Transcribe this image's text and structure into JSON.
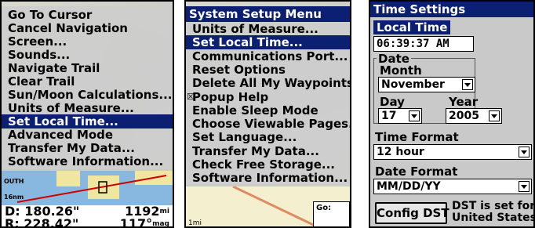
{
  "panel_left": {
    "menu_items": [
      {
        "label": "Go To Cursor",
        "selected": false
      },
      {
        "label": "Cancel Navigation",
        "selected": false
      },
      {
        "label": "Screen...",
        "selected": false
      },
      {
        "label": "Sounds...",
        "selected": false
      },
      {
        "label": "Navigate Trail",
        "selected": false
      },
      {
        "label": "Clear Trail",
        "selected": false
      },
      {
        "label": "Sun/Moon Calculations...",
        "selected": false
      },
      {
        "label": "Units of Measure...",
        "selected": false
      },
      {
        "label": "Set Local Time...",
        "selected": true
      },
      {
        "label": "Advanced Mode",
        "selected": false
      },
      {
        "label": "Transfer My Data...",
        "selected": false
      },
      {
        "label": "Software Information...",
        "selected": false
      }
    ],
    "map_label": "OUTH",
    "map_label2": "16nm",
    "readout": {
      "d_label": "D:",
      "d_value": "180.26\"",
      "d_right": "1192",
      "d_right_unit": "mi",
      "r_label": "R:",
      "r_value": "228.42\"",
      "r_right": "117°",
      "r_right_unit": "mag"
    }
  },
  "panel_middle": {
    "title": "System Setup Menu",
    "menu_items": [
      {
        "label": "Units of Measure...",
        "selected": false
      },
      {
        "label": "Set Local Time...",
        "selected": true
      },
      {
        "label": "Communications Port...",
        "selected": false
      },
      {
        "label": "Reset Options",
        "selected": false
      },
      {
        "label": "Delete All My Waypoints",
        "selected": false
      },
      {
        "label": "Popup Help",
        "selected": false,
        "checked": true
      },
      {
        "label": "Enable Sleep Mode",
        "selected": false
      },
      {
        "label": "Choose Viewable Pages...",
        "selected": false
      },
      {
        "label": "Set Language...",
        "selected": false
      },
      {
        "label": "Transfer My Data...",
        "selected": false
      },
      {
        "label": "Check Free Storage...",
        "selected": false
      },
      {
        "label": "Software Information...",
        "selected": false
      }
    ],
    "go_label": "Go:",
    "scale_label": "1mi"
  },
  "panel_right": {
    "title": "Time Settings",
    "local_time_label": "Local Time",
    "local_time_value": "06:39:37 AM",
    "date_label": "Date",
    "month_label": "Month",
    "month_value": "November",
    "day_label": "Day",
    "day_value": "17",
    "year_label": "Year",
    "year_value": "2005",
    "time_format_label": "Time Format",
    "time_format_value": "12 hour",
    "date_format_label": "Date Format",
    "date_format_value": "MM/DD/YY",
    "config_dst_label": "Config DST",
    "dst_note_line1": "DST is set for",
    "dst_note_line2": "United States"
  },
  "colors": {
    "highlight": "#0b1f73",
    "panel_bg": "#c9c9c9",
    "water": "#88b8df"
  }
}
